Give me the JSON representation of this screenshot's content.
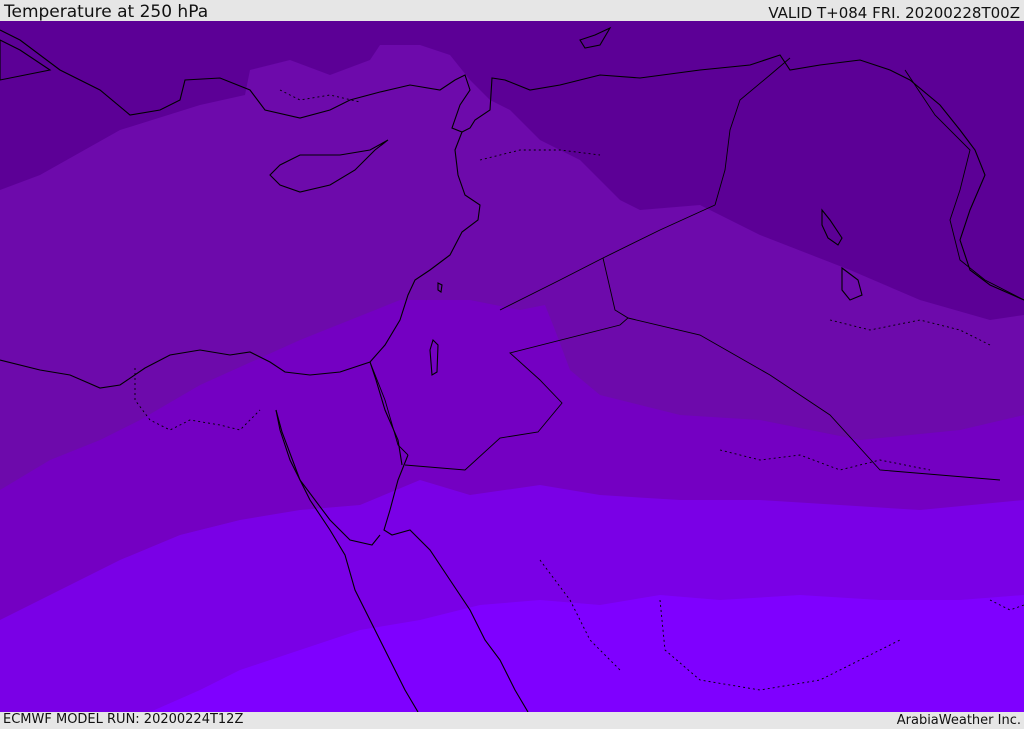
{
  "header": {
    "title": "Temperature at 250 hPa",
    "valid": "VALID T+084 FRI. 20200228T00Z"
  },
  "footer": {
    "model_run": "ECMWF MODEL RUN: 20200224T12Z",
    "credit": "ArabiaWeather Inc."
  },
  "map": {
    "field": "temperature",
    "level": "250 hPa",
    "region": "Eastern Mediterranean, Levant, Sinai, Northern Arabia",
    "band_colors": [
      "#5c0096",
      "#6d0aab",
      "#7400c2",
      "#7a00e6",
      "#7f00ff",
      "#6a14ff"
    ],
    "border_color": "#000000"
  }
}
